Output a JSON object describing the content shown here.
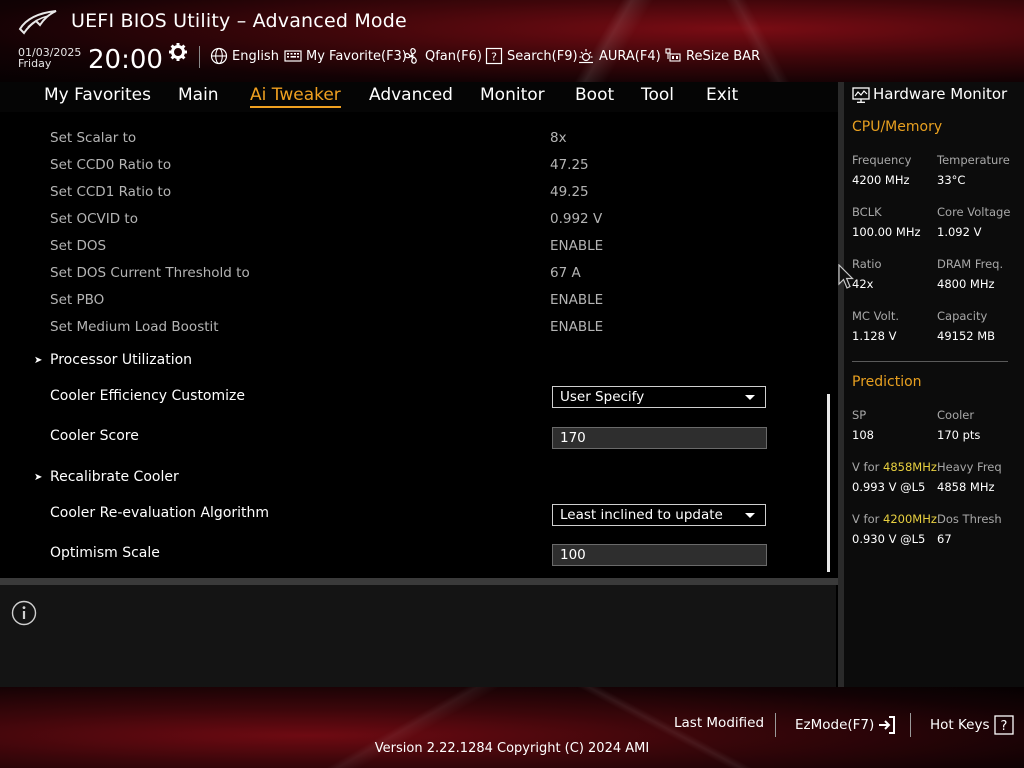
{
  "header": {
    "title": "UEFI BIOS Utility – Advanced Mode",
    "date": "01/03/2025",
    "day": "Friday",
    "time": "20:00",
    "tools": [
      {
        "label": "English",
        "icon": "globe-icon"
      },
      {
        "label": "My Favorite(F3)",
        "icon": "keyboard-icon"
      },
      {
        "label": "Qfan(F6)",
        "icon": "fan-icon"
      },
      {
        "label": "Search(F9)",
        "icon": "search-help-icon"
      },
      {
        "label": "AURA(F4)",
        "icon": "aura-light-icon"
      },
      {
        "label": "ReSize BAR",
        "icon": "resize-bar-icon"
      }
    ]
  },
  "nav": {
    "tabs": [
      "My Favorites",
      "Main",
      "Ai Tweaker",
      "Advanced",
      "Monitor",
      "Boot",
      "Tool",
      "Exit"
    ],
    "active": "Ai Tweaker"
  },
  "main": {
    "settings": [
      {
        "label": "Set Scalar to",
        "value": "8x"
      },
      {
        "label": "Set CCD0 Ratio to",
        "value": "47.25"
      },
      {
        "label": "Set CCD1 Ratio to",
        "value": "49.25"
      },
      {
        "label": "Set OCVID to",
        "value": "0.992 V"
      },
      {
        "label": "Set DOS",
        "value": "ENABLE"
      },
      {
        "label": "Set DOS Current Threshold to",
        "value": "67 A"
      },
      {
        "label": "Set PBO",
        "value": "ENABLE"
      },
      {
        "label": "Set Medium Load Boostit",
        "value": "ENABLE"
      }
    ],
    "processor_utilization": "Processor Utilization",
    "cooler_efficiency": {
      "label": "Cooler Efficiency Customize",
      "value": "User Specify"
    },
    "cooler_score": {
      "label": "Cooler Score",
      "value": "170"
    },
    "recalibrate": "Recalibrate Cooler",
    "reeval": {
      "label": "Cooler Re-evaluation Algorithm",
      "value": "Least inclined to update"
    },
    "optimism": {
      "label": "Optimism Scale",
      "value": "100"
    }
  },
  "hardware_monitor": {
    "title": "Hardware Monitor",
    "cpu_memory": {
      "title": "CPU/Memory",
      "items": [
        {
          "label": "Frequency",
          "value": "4200 MHz"
        },
        {
          "label": "Temperature",
          "value": "33°C"
        },
        {
          "label": "BCLK",
          "value": "100.00 MHz"
        },
        {
          "label": "Core Voltage",
          "value": "1.092 V"
        },
        {
          "label": "Ratio",
          "value": "42x"
        },
        {
          "label": "DRAM Freq.",
          "value": "4800 MHz"
        },
        {
          "label": "MC Volt.",
          "value": "1.128 V"
        },
        {
          "label": "Capacity",
          "value": "49152 MB"
        }
      ]
    },
    "prediction": {
      "title": "Prediction",
      "sp_label": "SP",
      "sp_value": "108",
      "cooler_label": "Cooler",
      "cooler_value": "170 pts",
      "v_prefix": "V for ",
      "v1_freq": "4858MHz",
      "v1_value": "0.993 V @L5",
      "heavy_label": "Heavy Freq",
      "heavy_value": "4858 MHz",
      "v2_freq": "4200MHz",
      "v2_value": "0.930 V @L5",
      "dos_label": "Dos Thresh",
      "dos_value": "67"
    }
  },
  "footer": {
    "last_modified": "Last Modified",
    "ezmode": "EzMode(F7)",
    "hotkeys": "Hot Keys",
    "version": "Version 2.22.1284 Copyright (C) 2024 AMI"
  },
  "colors": {
    "accent": "#f0a020",
    "highlight": "#e8d040",
    "brand_red": "#7a0c14"
  }
}
